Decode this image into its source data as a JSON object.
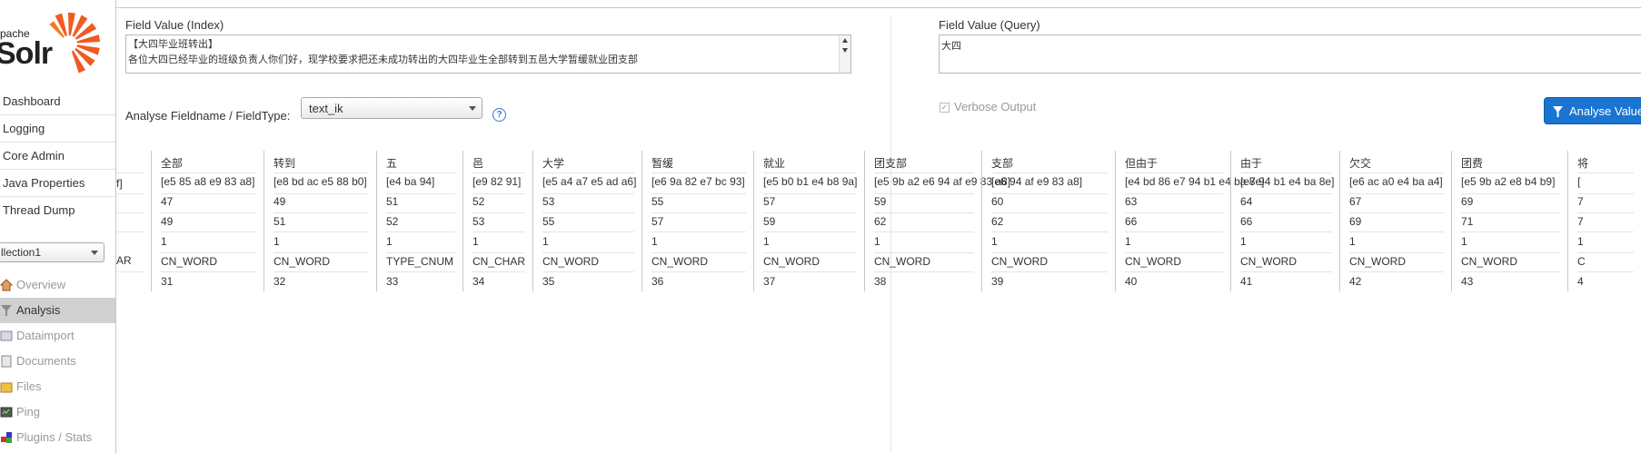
{
  "sidebar": {
    "logo_small": "pache",
    "logo_big": "Solr",
    "nav": [
      "Dashboard",
      "Logging",
      "Core Admin",
      "Java Properties",
      "Thread Dump"
    ],
    "core_selected": "llection1",
    "core_menu": [
      "Overview",
      "Analysis",
      "Dataimport",
      "Documents",
      "Files",
      "Ping",
      "Plugins / Stats"
    ],
    "active_core_item": "Analysis"
  },
  "main": {
    "index_label": "Field Value (Index)",
    "index_line1": "【大四毕业班转出】",
    "index_line2": "各位大四已经毕业的班级负责人你们好，现学校要求把还未成功转出的大四毕业生全部转到五邑大学暂缓就业团支部",
    "query_label": "Field Value (Query)",
    "query_value": "大四",
    "fieldtype_label": "Analyse Fieldname / FieldType:",
    "fieldtype_value": "text_ik",
    "help_glyph": "?",
    "verbose_label": "Verbose Output",
    "verbose_checked": "✓",
    "analyse_button": "Analyse Values"
  },
  "partial_col": {
    "bytes": "f]",
    "type": "AR"
  },
  "tokens": [
    {
      "text": "全部",
      "bytes": "[e5 85 a8 e9 83 a8]",
      "start": "47",
      "end": "49",
      "posinc": "1",
      "type": "CN_WORD",
      "position": "31"
    },
    {
      "text": "转到",
      "bytes": "[e8 bd ac e5 88 b0]",
      "start": "49",
      "end": "51",
      "posinc": "1",
      "type": "CN_WORD",
      "position": "32"
    },
    {
      "text": "五",
      "bytes": "[e4 ba 94]",
      "start": "51",
      "end": "52",
      "posinc": "1",
      "type": "TYPE_CNUM",
      "position": "33"
    },
    {
      "text": "邑",
      "bytes": "[e9 82 91]",
      "start": "52",
      "end": "53",
      "posinc": "1",
      "type": "CN_CHAR",
      "position": "34"
    },
    {
      "text": "大学",
      "bytes": "[e5 a4 a7 e5 ad a6]",
      "start": "53",
      "end": "55",
      "posinc": "1",
      "type": "CN_WORD",
      "position": "35"
    },
    {
      "text": "暂缓",
      "bytes": "[e6 9a 82 e7 bc 93]",
      "start": "55",
      "end": "57",
      "posinc": "1",
      "type": "CN_WORD",
      "position": "36"
    },
    {
      "text": "就业",
      "bytes": "[e5 b0 b1 e4 b8 9a]",
      "start": "57",
      "end": "59",
      "posinc": "1",
      "type": "CN_WORD",
      "position": "37"
    },
    {
      "text": "团支部",
      "bytes": "[e5 9b a2 e6 94 af e9 83 a8]",
      "start": "59",
      "end": "62",
      "posinc": "1",
      "type": "CN_WORD",
      "position": "38"
    },
    {
      "text": "支部",
      "bytes": "[e6 94 af e9 83 a8]",
      "start": "60",
      "end": "62",
      "posinc": "1",
      "type": "CN_WORD",
      "position": "39"
    },
    {
      "text": "但由于",
      "bytes": "[e4 bd 86 e7 94 b1 e4 ba 8e]",
      "start": "63",
      "end": "66",
      "posinc": "1",
      "type": "CN_WORD",
      "position": "40"
    },
    {
      "text": "由于",
      "bytes": "[e7 94 b1 e4 ba 8e]",
      "start": "64",
      "end": "66",
      "posinc": "1",
      "type": "CN_WORD",
      "position": "41"
    },
    {
      "text": "欠交",
      "bytes": "[e6 ac a0 e4 ba a4]",
      "start": "67",
      "end": "69",
      "posinc": "1",
      "type": "CN_WORD",
      "position": "42"
    },
    {
      "text": "团费",
      "bytes": "[e5 9b a2 e8 b4 b9]",
      "start": "69",
      "end": "71",
      "posinc": "1",
      "type": "CN_WORD",
      "position": "43"
    },
    {
      "text": "将",
      "bytes": "[",
      "start": "7",
      "end": "7",
      "posinc": "1",
      "type": "C",
      "position": "4"
    }
  ],
  "colors": {
    "accent": "#1a75d2",
    "border": "#c8c8c8"
  }
}
